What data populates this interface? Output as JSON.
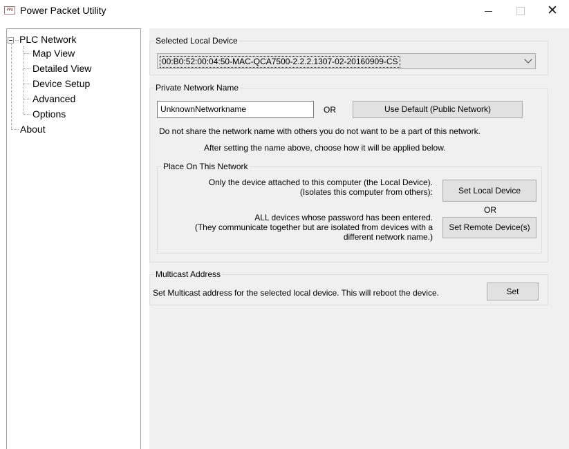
{
  "window": {
    "title": "Power Packet Utility",
    "icon_text": "PPU"
  },
  "nav": {
    "root": "PLC Network",
    "children": [
      "Map View",
      "Detailed View",
      "Device Setup",
      "Advanced",
      "Options"
    ],
    "about": "About"
  },
  "selected_device": {
    "group_title": "Selected Local Device",
    "value": "00:B0:52:00:04:50-MAC-QCA7500-2.2.2.1307-02-20160909-CS"
  },
  "private_network": {
    "group_title": "Private Network Name",
    "name_value": "UnknownNetworkname",
    "or_label": "OR",
    "use_default_label": "Use Default (Public Network)",
    "warning_text": "Do not share the network name with others you do not want to be a part of this network.",
    "instruction_text": "After setting the name above, choose how it will be applied below.",
    "place": {
      "group_title": "Place On This Network",
      "local_desc_line1": "Only the device attached to this computer (the Local Device).",
      "local_desc_line2": "(Isolates this computer from others):",
      "set_local_label": "Set Local Device",
      "or_label": "OR",
      "remote_desc_line1": "ALL devices whose password has been entered.",
      "remote_desc_line2": "(They communicate together but are isolated from devices with a",
      "remote_desc_line3": "different network name.)",
      "set_remote_label": "Set Remote Device(s)"
    }
  },
  "multicast": {
    "group_title": "Multicast Address",
    "description": "Set Multicast address for the selected local device. This will reboot the device.",
    "set_label": "Set"
  }
}
